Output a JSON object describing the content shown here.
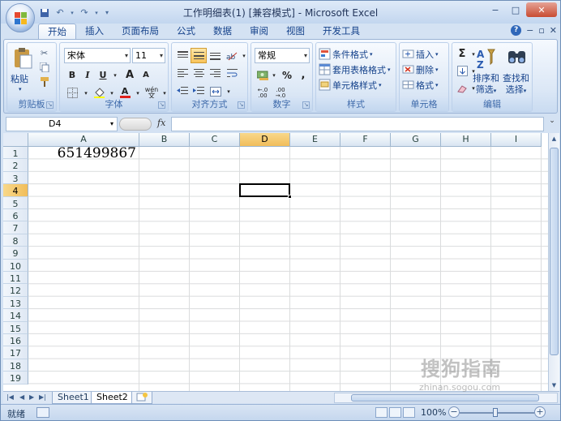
{
  "window": {
    "title": "工作明细表(1)  [兼容模式] - Microsoft Excel",
    "controls": [
      "−",
      "□",
      "✕"
    ]
  },
  "tabs": [
    "开始",
    "插入",
    "页面布局",
    "公式",
    "数据",
    "审阅",
    "视图",
    "开发工具"
  ],
  "active_tab": "开始",
  "tab_right": {
    "help": "?",
    "min": "−",
    "restore": "▫",
    "close": "✕"
  },
  "ribbon": {
    "clipboard": {
      "label": "剪贴板",
      "paste": "粘贴"
    },
    "font": {
      "label": "字体",
      "name": "宋体",
      "size": "11",
      "bold": "B",
      "italic": "I",
      "underline": "U",
      "grow": "A",
      "shrink": "A",
      "font_color": "A",
      "wen": "wén"
    },
    "alignment": {
      "label": "对齐方式"
    },
    "number": {
      "label": "数字",
      "format": "常规",
      "percent": "%",
      "comma": ","
    },
    "styles": {
      "label": "样式",
      "conditional": "条件格式",
      "table": "套用表格格式",
      "cell_styles": "单元格样式"
    },
    "cells": {
      "label": "单元格",
      "insert": "插入",
      "delete": "删除",
      "format": "格式"
    },
    "editing": {
      "label": "编辑",
      "sort": "排序和",
      "filter": "筛选",
      "find": "查找和",
      "select": "选择",
      "sigma": "Σ"
    }
  },
  "formula_bar": {
    "name_box": "D4",
    "fx": "fx",
    "formula": ""
  },
  "columns": [
    "A",
    "B",
    "C",
    "D",
    "E",
    "F",
    "G",
    "H",
    "I"
  ],
  "selected_column": "D",
  "rows": [
    "1",
    "2",
    "3",
    "4",
    "5",
    "6",
    "7",
    "8",
    "9",
    "10",
    "11",
    "12",
    "13",
    "14",
    "15",
    "16",
    "17",
    "18",
    "19"
  ],
  "selected_row": "4",
  "cells": {
    "A1": "651499867"
  },
  "sheets": [
    "Sheet1",
    "Sheet2"
  ],
  "active_sheet": "Sheet2",
  "status": {
    "ready": "就绪",
    "zoom": "100%"
  },
  "watermark": {
    "main": "搜狗指南",
    "url": "zhinan.sogou.com"
  }
}
